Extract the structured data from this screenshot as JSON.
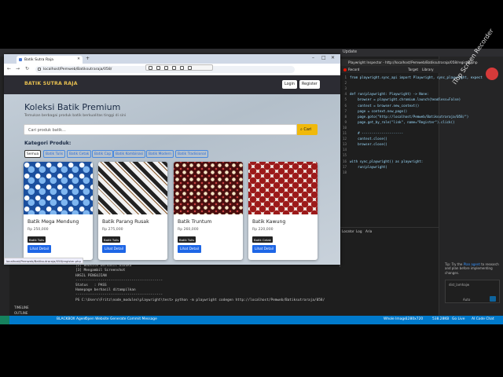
{
  "vscode": {
    "menu_label": "Update",
    "tip": {
      "prefix": "Tip:",
      "text_before": "Try the",
      "link": "Plan agent",
      "text_after": "to research and plan before implementing changes."
    },
    "chat_context": "dist_lamhajw",
    "chat_mode": "Auto",
    "terminal": [
      "[1] Membuka Website...",
      "[2] Website berhasil dibuka",
      "[3] Mengambil Screenshot",
      "",
      "HASIL PENGUJIAN",
      "------------------------------------------",
      "Status   : PASS",
      "Homepage berhasil ditampilkan",
      "------------------------------------------",
      "PS C:\\Users\\Fritz\\node_modules\\playwright\\test> python -m playwright codegen http://localhost/Pemweb/Batiksutraraja/058/"
    ],
    "outline": [
      "TIMELINE",
      "OUTLINE"
    ],
    "statusbar": {
      "agent": "BLACKBOX Agent",
      "open_website": "Open Website",
      "commit": "Generate Commit Message",
      "whole_image": "Whole Image",
      "resolution": "1280x720",
      "size": "538.28KB",
      "golive": "Go Live",
      "code_chat": "AI Code Chat"
    }
  },
  "inspector": {
    "title": "Playwright Inspector - http://localhost/Pemweb/Batiksutraraja/058/register.php",
    "record_label": "Record",
    "target_label": "Target",
    "target_value": "Library",
    "code": [
      "from playwright.sync_api import Playwright, sync_playwright, expect",
      "",
      "",
      "def run(playwright: Playwright) -> None:",
      "    browser = playwright.chromium.launch(headless=False)",
      "    context = browser.new_context()",
      "    page = context.new_page()",
      "    page.goto(\"http://localhost/Pemweb/Batiksutraraja/058/\")",
      "    page.get_by_role(\"link\", name=\"Register\").click()",
      "",
      "    # ---------------------",
      "    context.close()",
      "    browser.close()",
      "",
      "",
      "with sync_playwright() as playwright:",
      "    run(playwright)",
      ""
    ],
    "bottom_tabs": [
      "Locator",
      "Log",
      "Aria"
    ]
  },
  "browser": {
    "tab_title": "Batik Sutra Raja",
    "url": "localhost/Pemweb/Batiksutraraja/058/",
    "status_link": "localhost/Pemweb/Batiksutraraja/058/register.php"
  },
  "site": {
    "brand": "BATIK SUTRA RAJA",
    "login": "Login",
    "register": "Register",
    "title": "Koleksi Batik Premium",
    "subtitle": "Temukan berbagai produk batik berkualitas tinggi di sini",
    "search_placeholder": "Cari produk batik...",
    "search_button": "Cari",
    "kategori_label": "Kategori Produk:",
    "categories": [
      "Semua",
      "Batik Tulis",
      "Batik Cetak",
      "Batik Cap",
      "Batik Kombinasi",
      "Batik Modern",
      "Batik Tradisional"
    ],
    "products": [
      {
        "name": "Batik Mega Mendung",
        "price": "Rp 250,000",
        "badge": "Batik Tulis",
        "button": "Lihat Detail"
      },
      {
        "name": "Batik Parang Rusak",
        "price": "Rp 275,000",
        "badge": "Batik Tulis",
        "button": "Lihat Detail"
      },
      {
        "name": "Batik Truntum",
        "price": "Rp 260,000",
        "badge": "Batik Tulis",
        "button": "Lihat Detail"
      },
      {
        "name": "Batik Kawung",
        "price": "Rp 220,000",
        "badge": "Batik Cetak",
        "button": "Lihat Detail"
      }
    ]
  },
  "watermark": "iTop Screen Recorder"
}
